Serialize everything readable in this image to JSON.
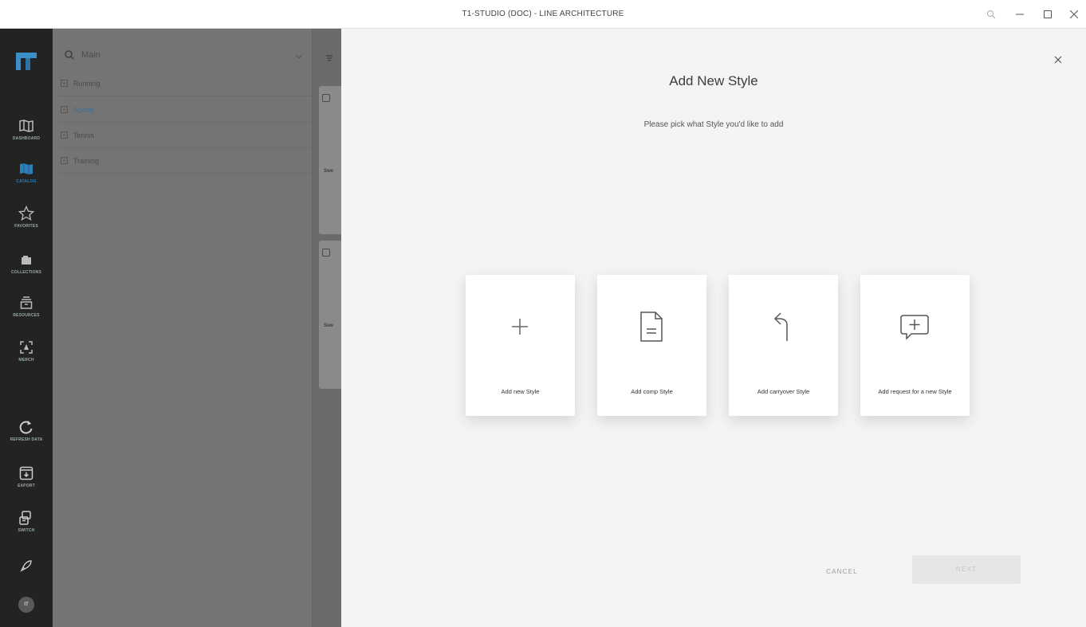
{
  "window": {
    "title": "T1-STUDIO (DOC) - LINE ARCHITECTURE"
  },
  "rail": {
    "avatar": "IT",
    "items": [
      {
        "label": "DASHBOARD",
        "icon": "map-book-icon"
      },
      {
        "label": "CATALOG",
        "icon": "catalog-icon"
      },
      {
        "label": "FAVORITES",
        "icon": "star-icon"
      },
      {
        "label": "COLLECTIONS",
        "icon": "collections-icon"
      },
      {
        "label": "RESOURCES",
        "icon": "resources-icon"
      },
      {
        "label": "MERCH",
        "icon": "merch-icon"
      },
      {
        "label": "REFRESH DATA",
        "icon": "refresh-icon"
      },
      {
        "label": "EXPORT",
        "icon": "export-icon"
      },
      {
        "label": "SWITCH",
        "icon": "switch-icon"
      }
    ],
    "active_color": "#2d7fb8"
  },
  "tree": {
    "search_value": "Main",
    "rows": [
      {
        "label": "Running"
      },
      {
        "label": "Sports"
      },
      {
        "label": "Tennis"
      },
      {
        "label": "Training"
      }
    ]
  },
  "cards": {
    "label_prefix": "Swe"
  },
  "modal": {
    "title": "Add New Style",
    "subtitle": "Please pick what Style you'd like to add",
    "options": [
      {
        "label": "Add new Style",
        "icon": "plus-icon"
      },
      {
        "label": "Add comp Style",
        "icon": "document-icon"
      },
      {
        "label": "Add carryover Style",
        "icon": "turn-back-arrow-icon"
      },
      {
        "label": "Add request for a new Style",
        "icon": "comment-plus-icon"
      }
    ],
    "cancel": "CANCEL",
    "next": "NEXT"
  }
}
